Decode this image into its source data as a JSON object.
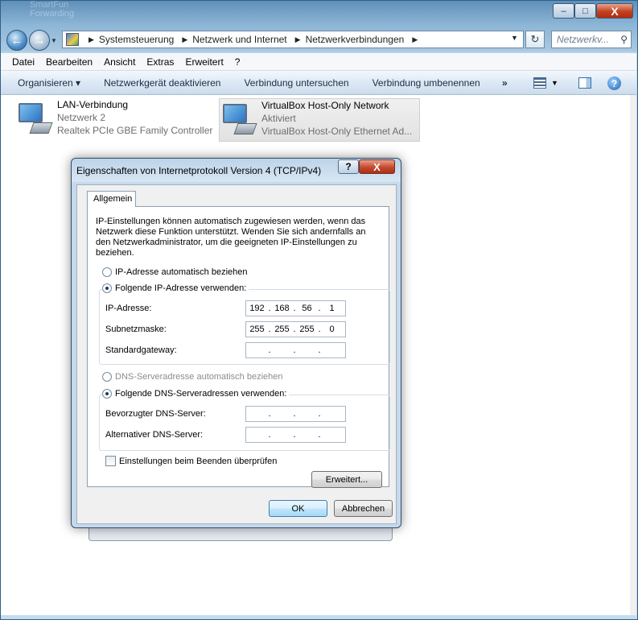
{
  "desktop": {
    "ghost_lines": [
      "SmartFun",
      "Forwarding"
    ]
  },
  "titlebar": {
    "minimize": "–",
    "maximize": "□",
    "close": "X"
  },
  "address_bar": {
    "crumbs": [
      "Systemsteuerung",
      "Netzwerk und Internet",
      "Netzwerkverbindungen"
    ],
    "separator": "▶",
    "search_placeholder": "Netzwerkv..."
  },
  "menu": [
    "Datei",
    "Bearbeiten",
    "Ansicht",
    "Extras",
    "Erweitert",
    "?"
  ],
  "commands": {
    "organize": "Organisieren ▾",
    "items": [
      "Netzwerkgerät deaktivieren",
      "Verbindung untersuchen",
      "Verbindung umbenennen"
    ],
    "more": "»"
  },
  "adapters": [
    {
      "name": "LAN-Verbindung",
      "status": "Netzwerk  2",
      "device": "Realtek PCIe GBE Family Controller"
    },
    {
      "name": "VirtualBox Host-Only Network",
      "status": "Aktiviert",
      "device": "VirtualBox Host-Only Ethernet Ad..."
    }
  ],
  "dialog": {
    "title": "Eigenschaften von Internetprotokoll Version 4 (TCP/IPv4)",
    "help": "?",
    "close": "X",
    "tab": "Allgemein",
    "intro": "IP-Einstellungen können automatisch zugewiesen werden, wenn das Netzwerk diese Funktion unterstützt. Wenden Sie sich andernfalls an den Netzwerkadministrator, um die geeigneten IP-Einstellungen zu beziehen.",
    "ip_auto": "IP-Adresse automatisch beziehen",
    "ip_manual": "Folgende IP-Adresse verwenden:",
    "ip_label": "IP-Adresse:",
    "ip_value": [
      "192",
      "168",
      "56",
      "1"
    ],
    "mask_label": "Subnetzmaske:",
    "mask_value": [
      "255",
      "255",
      "255",
      "0"
    ],
    "gateway_label": "Standardgateway:",
    "gateway_value": [
      "",
      "",
      "",
      ""
    ],
    "dns_auto": "DNS-Serveradresse automatisch beziehen",
    "dns_manual": "Folgende DNS-Serveradressen verwenden:",
    "dns1_label": "Bevorzugter DNS-Server:",
    "dns1_value": [
      "",
      "",
      "",
      ""
    ],
    "dns2_label": "Alternativer DNS-Server:",
    "dns2_value": [
      "",
      "",
      "",
      ""
    ],
    "validate": "Einstellungen beim Beenden überprüfen",
    "advanced": "Erweitert...",
    "ok": "OK",
    "cancel": "Abbrechen",
    "selected_ip_mode": "manual",
    "selected_dns_mode": "manual"
  }
}
